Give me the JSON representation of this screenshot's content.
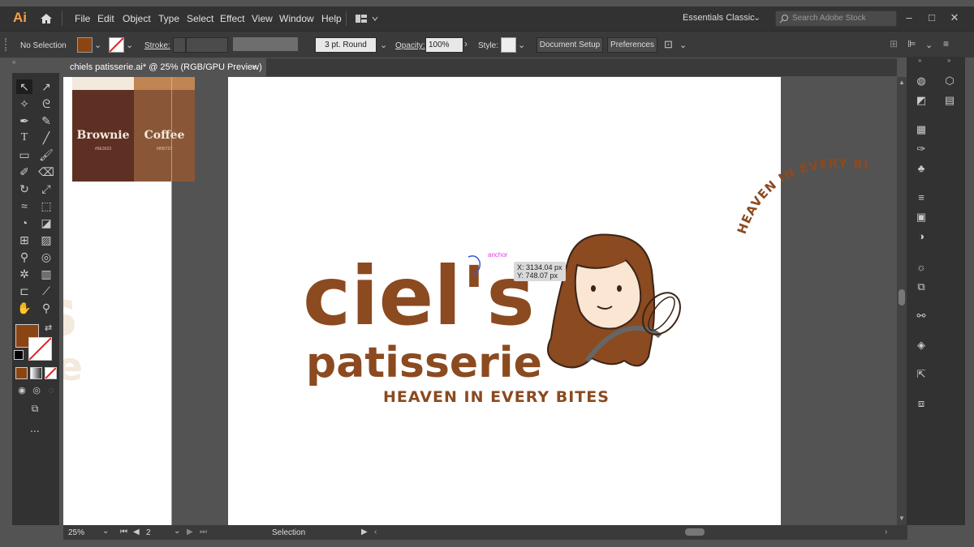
{
  "menubar": {
    "logo": "Ai",
    "items": [
      "File",
      "Edit",
      "Object",
      "Type",
      "Select",
      "Effect",
      "View",
      "Window",
      "Help"
    ],
    "workspace": "Essentials Classic",
    "search_placeholder": "Search Adobe Stock"
  },
  "controlbar": {
    "selection": "No Selection",
    "stroke_label": "Stroke:",
    "brush": "3 pt. Round",
    "opacity_label": "Opacity:",
    "opacity_value": "100%",
    "style_label": "Style:",
    "document_setup": "Document Setup",
    "preferences": "Preferences"
  },
  "tab": {
    "title": "chiels patisserie.ai* @ 25% (RGB/GPU Preview)",
    "close": "×"
  },
  "swatches": [
    {
      "name": "Brownie",
      "code": "#5E3023",
      "color": "#5e3023"
    },
    {
      "name": "Coffee",
      "code": "#895737",
      "color": "#895737"
    }
  ],
  "colors": {
    "fill": "#8b4513",
    "brand": "#8b4a1f",
    "caramel": "#c08552",
    "cream": "#f3e9dc"
  },
  "logo": {
    "line1": "ciel's",
    "line2": "patisserie",
    "tagline": "HEAVEN IN EVERY BITES",
    "arc_text": "HEAVEN IN EVERY BITES",
    "anchor_label": "anchor",
    "coord_x": "X: 3134.04 px",
    "coord_y": "Y: 748.07 px"
  },
  "statusbar": {
    "zoom": "25%",
    "artboard_num": "2",
    "tool": "Selection"
  },
  "more_tools": "..."
}
